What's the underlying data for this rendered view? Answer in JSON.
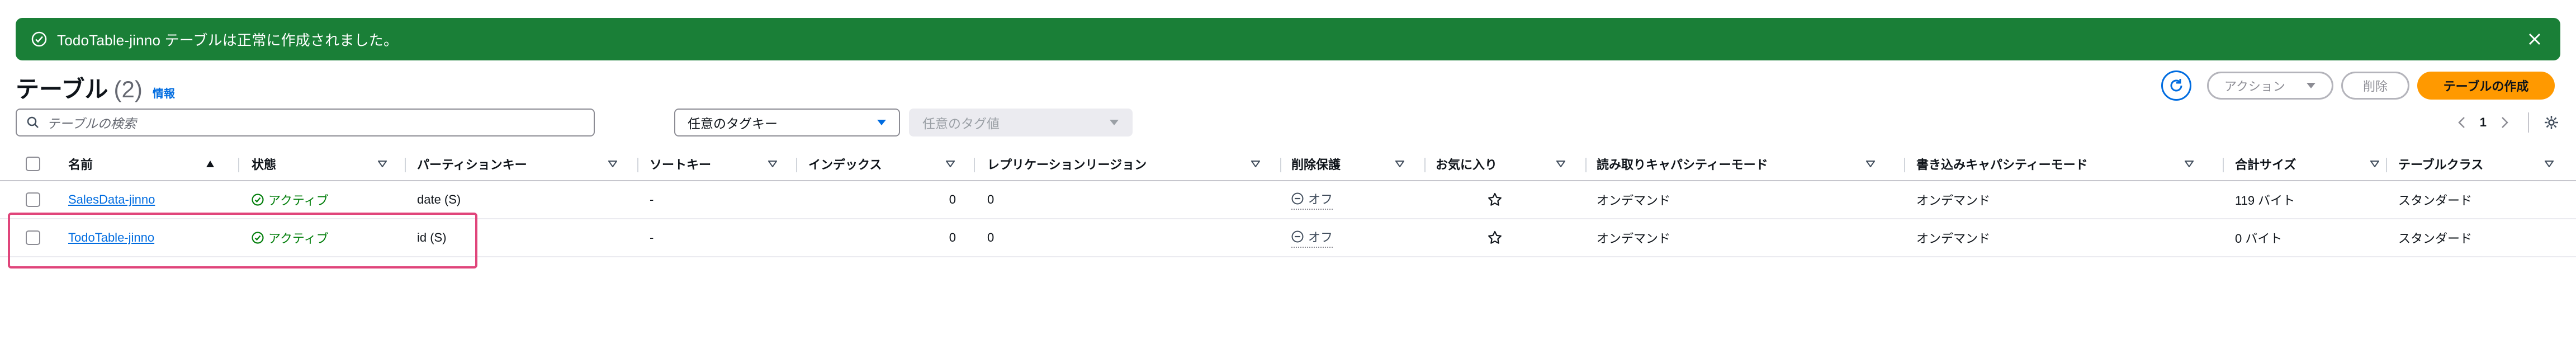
{
  "banner": {
    "message": "TodoTable-jinno テーブルは正常に作成されました。"
  },
  "header": {
    "title": "テーブル",
    "count": "(2)",
    "info": "情報",
    "buttons": {
      "action": "アクション",
      "delete": "削除",
      "create": "テーブルの作成"
    }
  },
  "filters": {
    "search_placeholder": "テーブルの検索",
    "tag_key": "任意のタグキー",
    "tag_value": "任意のタグ値"
  },
  "pagination": {
    "page": "1"
  },
  "table": {
    "columns": [
      "名前",
      "状態",
      "パーティションキー",
      "ソートキー",
      "インデックス",
      "レプリケーションリージョン",
      "削除保護",
      "お気に入り",
      "読み取りキャパシティーモード",
      "書き込みキャパシティーモード",
      "合計サイズ",
      "テーブルクラス"
    ],
    "rows": [
      {
        "name": "SalesData-jinno",
        "status": "アクティブ",
        "partition_key": "date (S)",
        "sort_key": "-",
        "indexes": "0",
        "replication": "0",
        "deletion_protection": "オフ",
        "read_mode": "オンデマンド",
        "write_mode": "オンデマンド",
        "size": "119 バイト",
        "table_class": "スタンダード"
      },
      {
        "name": "TodoTable-jinno",
        "status": "アクティブ",
        "partition_key": "id (S)",
        "sort_key": "-",
        "indexes": "0",
        "replication": "0",
        "deletion_protection": "オフ",
        "read_mode": "オンデマンド",
        "write_mode": "オンデマンド",
        "size": "0 バイト",
        "table_class": "スタンダード"
      }
    ]
  },
  "colors": {
    "banner": "#1a7f37",
    "link": "#006ce0",
    "primary_button": "#ff9900",
    "status_ok": "#037f0c",
    "highlight": "#e0457b"
  }
}
